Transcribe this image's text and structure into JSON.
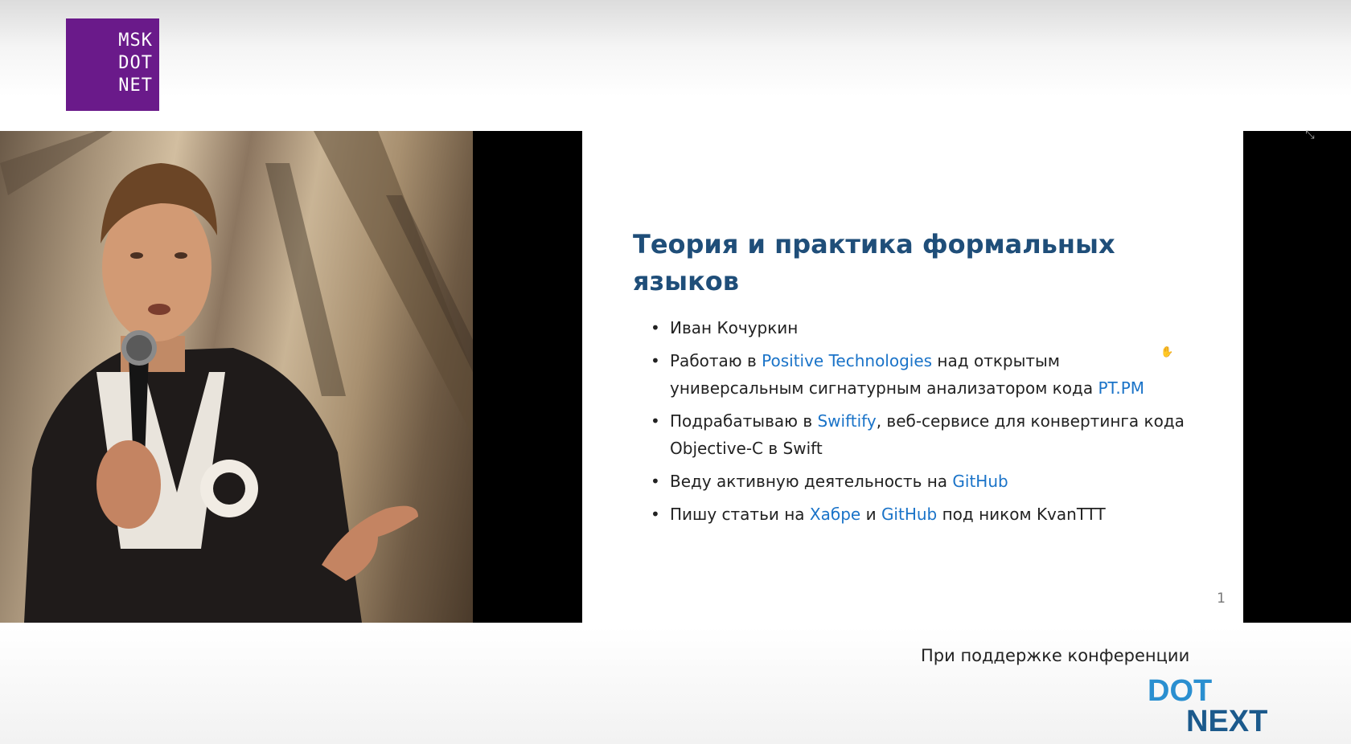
{
  "header": {
    "logo_lines": [
      "MSK",
      "DOT",
      "NET"
    ]
  },
  "slide": {
    "title": "Теория и практика формальных языков",
    "bullets": [
      {
        "parts": [
          {
            "text": "Иван Кочуркин",
            "link": false
          }
        ]
      },
      {
        "parts": [
          {
            "text": "Работаю в ",
            "link": false
          },
          {
            "text": "Positive Technologies",
            "link": true
          },
          {
            "text": " над открытым универсальным сигнатурным анализатором кода ",
            "link": false
          },
          {
            "text": "PT.PM",
            "link": true
          }
        ]
      },
      {
        "parts": [
          {
            "text": "Подрабатываю в ",
            "link": false
          },
          {
            "text": "Swiftify",
            "link": true
          },
          {
            "text": ", веб-сервисе для конвертинга кода Objective-C в Swift",
            "link": false
          }
        ]
      },
      {
        "parts": [
          {
            "text": "Веду активную деятельность на ",
            "link": false
          },
          {
            "text": "GitHub",
            "link": true
          }
        ]
      },
      {
        "parts": [
          {
            "text": "Пишу статьи на ",
            "link": false
          },
          {
            "text": "Хабре",
            "link": true
          },
          {
            "text": " и ",
            "link": false
          },
          {
            "text": "GitHub",
            "link": true
          },
          {
            "text": " под ником KvanTTT",
            "link": false
          }
        ]
      }
    ],
    "page_number": "1"
  },
  "footer": {
    "support_caption": "При поддержке конференции",
    "sponsor_logo_lines": [
      "DOT",
      "NEXT"
    ]
  },
  "colors": {
    "logo_bg": "#6a1a8a",
    "title": "#1f4e79",
    "link": "#1a73c8",
    "dotnext_dot": "#2a8fd0",
    "dotnext_next": "#1c5a8c"
  },
  "icons": {
    "fullscreen_exit": "compress-icon",
    "cursor": "hand-cursor-icon"
  }
}
